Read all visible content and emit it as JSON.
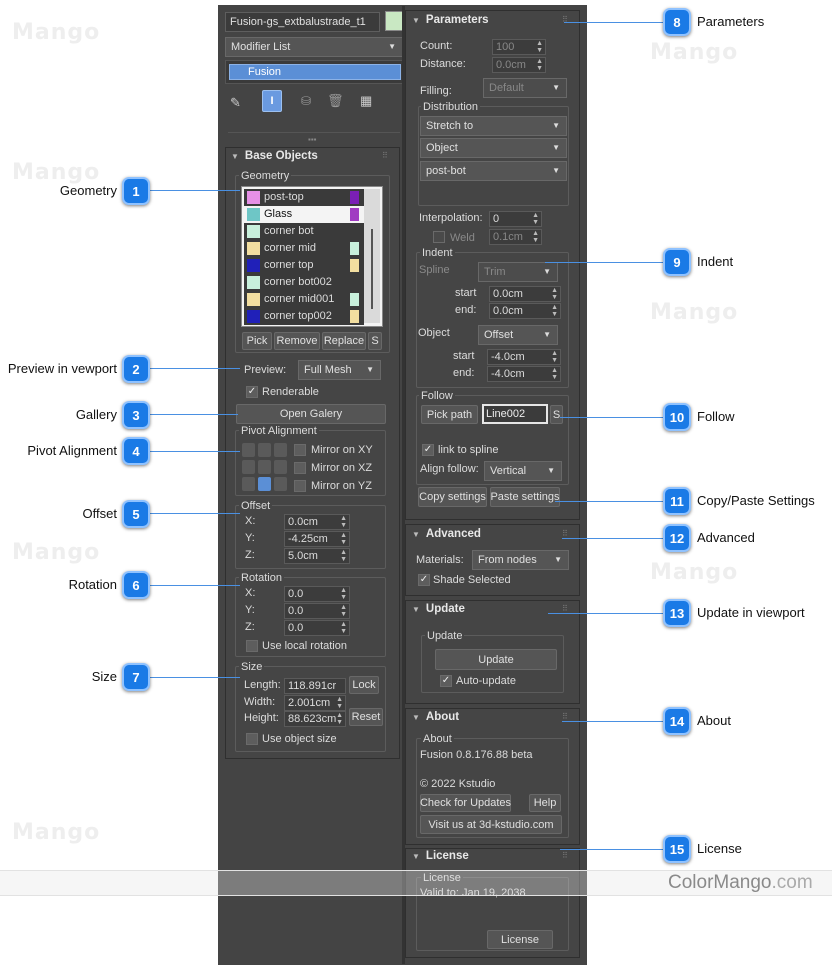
{
  "watermark": {
    "text": "ColorMango",
    "suffix": ".com"
  },
  "modifier": {
    "object_name": "Fusion-gs_extbalustrade_t1",
    "object_color": "#c9e8c3",
    "modifier_list_label": "Modifier List",
    "stack_item": "Fusion"
  },
  "base_objects": {
    "title": "Base Objects",
    "geometry_label": "Geometry",
    "items": [
      {
        "label": "post-top",
        "color": "#e690e6",
        "color2": "#7a1fb5"
      },
      {
        "label": "Glass",
        "color": "#6ec6c6",
        "color2": "#a03bc2",
        "selected": true
      },
      {
        "label": "corner bot",
        "color": "#c8f0dc",
        "color2": ""
      },
      {
        "label": "corner mid",
        "color": "#f2dea0",
        "color2": "#c8f0dc"
      },
      {
        "label": "corner top",
        "color": "#2020b8",
        "color2": "#f2dea0"
      },
      {
        "label": "corner bot002",
        "color": "#c8f0dc",
        "color2": ""
      },
      {
        "label": "corner mid001",
        "color": "#f2dea0",
        "color2": "#c8f0dc"
      },
      {
        "label": "corner top002",
        "color": "#2020b8",
        "color2": "#f2dea0"
      }
    ],
    "buttons": {
      "pick": "Pick",
      "remove": "Remove",
      "replace": "Replace",
      "s": "S"
    },
    "preview_label": "Preview:",
    "preview_value": "Full Mesh",
    "renderable": "Renderable",
    "open_gallery": "Open Galery",
    "pivot_label": "Pivot Alignment",
    "mirror_xy": "Mirror on XY",
    "mirror_xz": "Mirror on XZ",
    "mirror_yz": "Mirror on YZ",
    "offset_label": "Offset",
    "offset": {
      "x": "0.0cm",
      "y": "-4.25cm",
      "z": "5.0cm"
    },
    "rotation_label": "Rotation",
    "rotation": {
      "x": "0.0",
      "y": "0.0",
      "z": "0.0"
    },
    "use_local_rotation": "Use local rotation",
    "size_label": "Size",
    "size": {
      "length": "118.891cr",
      "width": "2.001cm",
      "height": "88.623cm"
    },
    "size_lbl": {
      "length": "Length:",
      "width": "Width:",
      "height": "Height:"
    },
    "lock": "Lock",
    "reset": "Reset",
    "use_object_size": "Use object size",
    "axis": {
      "x": "X:",
      "y": "Y:",
      "z": "Z:"
    }
  },
  "parameters": {
    "title": "Parameters",
    "count_label": "Count:",
    "count_value": "100",
    "distance_label": "Distance:",
    "distance_value": "0.0cm",
    "filling_label": "Filling:",
    "filling_value": "Default",
    "distribution_label": "Distribution",
    "dist_mode": "Stretch to",
    "dist_target": "Object",
    "dist_object": "post-bot",
    "interpolation_label": "Interpolation:",
    "interpolation_value": "0",
    "weld_label": "Weld",
    "weld_value": "0.1cm",
    "indent_label": "Indent",
    "spline_label": "Spline",
    "spline_mode": "Trim",
    "start_label": "start",
    "end_label": "end:",
    "spline_start": "0.0cm",
    "spline_end": "0.0cm",
    "object_label": "Object",
    "object_mode": "Offset",
    "object_start": "-4.0cm",
    "object_end": "-4.0cm",
    "follow_label": "Follow",
    "pick_path": "Pick path",
    "path_value": "Line002",
    "s": "S",
    "link_to_spline": "link to spline",
    "align_follow_label": "Align follow:",
    "align_follow_value": "Vertical",
    "copy_settings": "Copy settings",
    "paste_settings": "Paste settings"
  },
  "advanced": {
    "title": "Advanced",
    "materials_label": "Materials:",
    "materials_value": "From nodes",
    "shade_selected": "Shade Selected"
  },
  "update": {
    "title": "Update",
    "group_label": "Update",
    "button": "Update",
    "auto_update": "Auto-update"
  },
  "about": {
    "title": "About",
    "group_label": "About",
    "version": "Fusion 0.8.176.88 beta",
    "copyright": "© 2022 Kstudio",
    "check_updates": "Check for Updates",
    "help": "Help",
    "visit": "Visit us at 3d-kstudio.com"
  },
  "license": {
    "title": "License",
    "group_label": "License",
    "valid": "Valid to: Jan 19, 2038",
    "button": "License"
  },
  "callouts": [
    {
      "n": "1",
      "label": "Geometry"
    },
    {
      "n": "2",
      "label": "Preview in vewport"
    },
    {
      "n": "3",
      "label": "Gallery"
    },
    {
      "n": "4",
      "label": "Pivot Alignment"
    },
    {
      "n": "5",
      "label": "Offset"
    },
    {
      "n": "6",
      "label": "Rotation"
    },
    {
      "n": "7",
      "label": "Size"
    },
    {
      "n": "8",
      "label": "Parameters"
    },
    {
      "n": "9",
      "label": "Indent"
    },
    {
      "n": "10",
      "label": "Follow"
    },
    {
      "n": "11",
      "label": "Copy/Paste Settings"
    },
    {
      "n": "12",
      "label": "Advanced"
    },
    {
      "n": "13",
      "label": "Update in viewport"
    },
    {
      "n": "14",
      "label": "About"
    },
    {
      "n": "15",
      "label": "License"
    }
  ]
}
